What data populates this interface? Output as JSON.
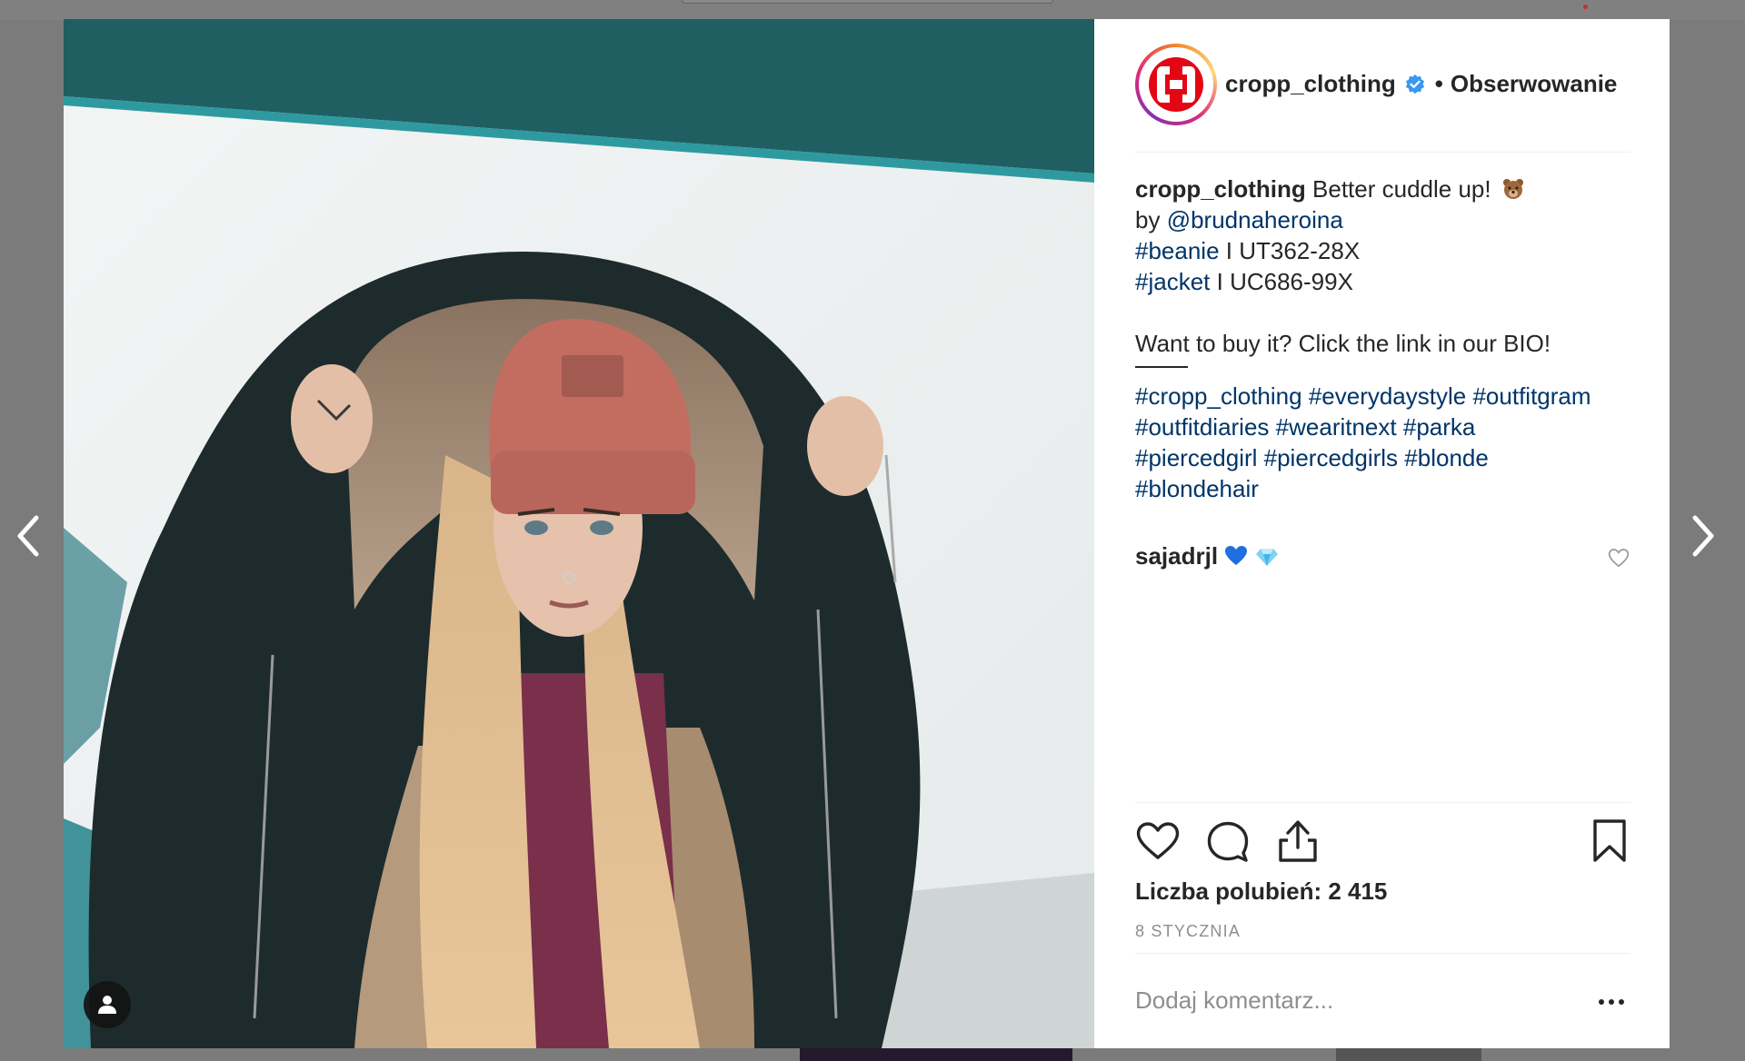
{
  "post": {
    "username": "cropp_clothing",
    "dot": "•",
    "follow_label": "Obserwowanie",
    "caption": {
      "user": "cropp_clothing",
      "text": "Better cuddle up!",
      "by_prefix": "by",
      "mention": "@brudnaheroina",
      "tag_beanie": "#beanie",
      "beanie_code": "I UT362-28X",
      "tag_jacket": "#jacket",
      "jacket_code": "I UC686-99X",
      "cta": "Want to buy it? Click the link in our BIO!",
      "hashtag_lines": [
        [
          "#cropp_clothing",
          "#everydaystyle",
          "#outfitgram"
        ],
        [
          "#outfitdiaries",
          "#wearitnext",
          "#parka"
        ],
        [
          "#piercedgirl",
          "#piercedgirls",
          "#blonde"
        ],
        [
          "#blondehair"
        ]
      ]
    },
    "comments": [
      {
        "user": "sajadrjl",
        "emojis": [
          "blue-heart",
          "gem"
        ]
      }
    ],
    "likes_label": "Liczba polubień: 2 415",
    "date": "8 STYCZNIA",
    "comment_placeholder": "Dodaj komentarz..."
  },
  "icons": {
    "like": "heart-icon",
    "comment": "comment-bubble-icon",
    "share": "share-icon",
    "save": "bookmark-icon",
    "prev": "chevron-left-icon",
    "next": "chevron-right-icon",
    "tagged_users": "user-icon",
    "verified": "verified-badge-icon",
    "options": "more-options-icon"
  },
  "colors": {
    "text": "#262626",
    "link": "#003569",
    "secondary": "#8e8e8e",
    "verified": "#3897f0",
    "brand_red": "#e30613"
  }
}
